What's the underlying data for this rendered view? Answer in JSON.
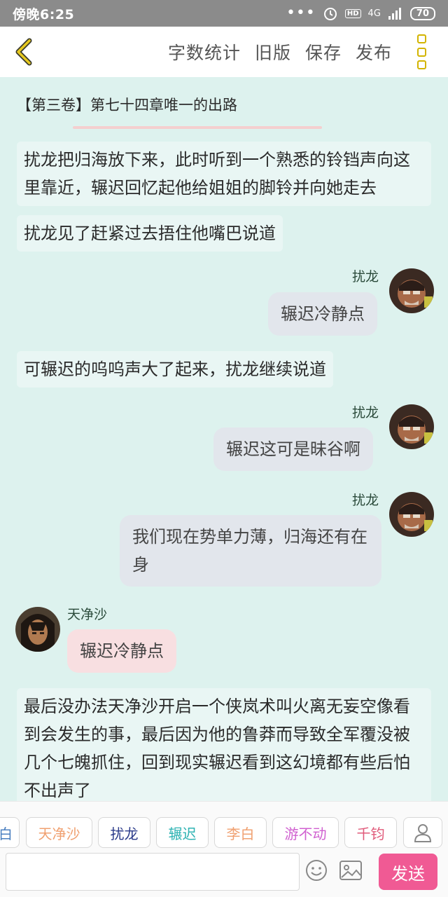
{
  "status_bar": {
    "time": "傍晚6:25",
    "signal": "4G",
    "hd": "HD",
    "battery": "70"
  },
  "toolbar": {
    "back_icon": "chevron-left-icon",
    "actions": [
      "字数统计",
      "旧版",
      "保存",
      "发布"
    ],
    "more_icon": "more-vertical-icon"
  },
  "chapter": {
    "title": "【第三卷】第七十四章唯一的出路"
  },
  "narration": [
    "扰龙把归海放下来，此时听到一个熟悉的铃铛声向这里靠近，辗迟回忆起他给姐姐的脚铃并向她走去",
    "扰龙见了赶紧过去捂住他嘴巴说道",
    "可辗迟的呜呜声大了起来，扰龙继续说道",
    "最后没办法天净沙开启一个侠岚术叫火离无妄空像看到会发生的事，最后因为他的鲁莽而导致全军覆没被几个七魄抓住，回到现实辗迟看到这幻境都有些后怕不出声了"
  ],
  "messages": [
    {
      "speaker": "扰龙",
      "text": "辗迟冷静点",
      "side": "right"
    },
    {
      "speaker": "扰龙",
      "text": "辗迟这可是昧谷啊",
      "side": "right"
    },
    {
      "speaker": "扰龙",
      "text": "我们现在势单力薄，归海还有在身",
      "side": "right"
    },
    {
      "speaker": "天净沙",
      "text": "辗迟冷静点",
      "side": "left"
    }
  ],
  "roles": [
    {
      "label": "白",
      "color": "#4a7fc0"
    },
    {
      "label": "天净沙",
      "color": "#f0a070"
    },
    {
      "label": "扰龙",
      "color": "#2a3a8a"
    },
    {
      "label": "辗迟",
      "color": "#2fb3b3"
    },
    {
      "label": "李白",
      "color": "#f0a070"
    },
    {
      "label": "游不动",
      "color": "#d060d0"
    },
    {
      "label": "千钧",
      "color": "#e05a7a"
    }
  ],
  "composer": {
    "placeholder": "",
    "send_label": "发送"
  },
  "colors": {
    "background": "#ddf2ee",
    "send_button": "#f05a94",
    "accent_icon": "#d3b400"
  }
}
